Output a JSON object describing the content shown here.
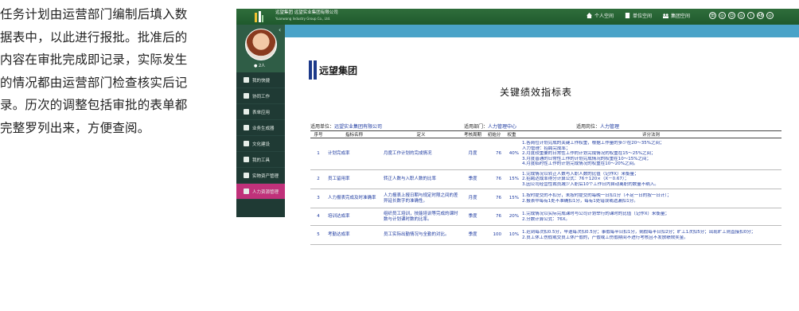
{
  "intro": "任务计划由运营部门编制后填入数据表中，以此进行报批。批准后的内容在审批完成即记录，实际发生的情况都由运营部门检查核实后记录。历次的调整包括审批的表单都完整罗列出来，方便查阅。",
  "header": {
    "brand_cn": "远望集团  远望实业集团有限公司",
    "brand_en": "Yuanwang Industry Group Co., Ltd.",
    "nav": [
      {
        "label": "个人空间",
        "icon": "home-icon"
      },
      {
        "label": "单位空间",
        "icon": "building-icon"
      },
      {
        "label": "集团空间",
        "icon": "group-icon"
      }
    ],
    "circles": [
      "田",
      "◎",
      "☺",
      "◎",
      "i",
      "AB",
      "◎"
    ]
  },
  "sidebar": {
    "status": "● 2人",
    "collapse": "‹",
    "items": [
      {
        "label": "我的快捷",
        "icon": "plus-circle-icon"
      },
      {
        "label": "协同工作",
        "icon": "people-icon"
      },
      {
        "label": "表单应用",
        "icon": "form-icon"
      },
      {
        "label": "业务生成器",
        "icon": "house-icon"
      },
      {
        "label": "文化建设",
        "icon": "culture-icon"
      },
      {
        "label": "我的工具",
        "icon": "toolbox-icon"
      },
      {
        "label": "实物资产管理",
        "icon": "asset-icon"
      },
      {
        "label": "人力资源管理",
        "icon": "hr-icon"
      }
    ],
    "active_index": 7
  },
  "doc": {
    "logo_text": "远望集团",
    "title": "关键绩效指标表",
    "unit_label": "适用单位：",
    "unit_value": "远望实业集团有限公司",
    "dept_label": "适用部门：",
    "dept_value": "人力管理中心",
    "post_label": "适用岗位：",
    "post_value": "人力管理",
    "columns": [
      "序号",
      "指标名称",
      "定义",
      "考核周期",
      "初始分",
      "权重",
      "评分法则"
    ],
    "rows": [
      {
        "no": "1",
        "name": "计划完成率",
        "def": "月度工作计划的完成情况",
        "cycle": "月度",
        "score": "76",
        "weight": "40%",
        "rules": [
          "1.各岗位计划完成的关键工作权重，根据工作量的多少在20～35%之间；",
          "   人力管理：招聘完成率；",
          "2.月度较重要的日常性工作的计划完成情况的权重在15～25%之间；",
          "3.月度普通的日常性工作的计划完成情况的权重在10～15%之间；",
          "4.月度临时性工作的计划完成情况的权重在10～20%之间。"
        ]
      },
      {
        "no": "2",
        "name": "员工留用率",
        "def": "转正人数与入职人数的比率",
        "cycle": "季度",
        "score": "76",
        "weight": "15%",
        "rules": [
          "1.完成情况以转正人数与入职人数的比值（记作X）来衡量；",
          "2.招聘达成率得分计算公式：76＋120×（X－0.67）；",
          "3.因公司经营性裁员减少入职后10个工作日内自动离职的数量不纳入。"
        ]
      },
      {
        "no": "3",
        "name": "人力报表完成及时准确率",
        "def": "人力报表上报日期与规定时限之间的差异延长数字的准确性。",
        "cycle": "月度",
        "score": "76",
        "weight": "15%",
        "rules": [
          "1.按时提交的不扣分，未按时提交的每晚一日扣1分（不足一日的按一日计）；",
          "2.报表中每有1处不准确扣1分，每有1处错误或遗漏扣1分。"
        ]
      },
      {
        "no": "4",
        "name": "培训达成率",
        "def": "组织员工培训，技能培训等完成的课时数与计划课时数的比率。",
        "cycle": "季度",
        "score": "76",
        "weight": "20%",
        "rules": [
          "1.完成情况以实际完成课时与公司计划举行的课时的比值（记作X）来衡量；",
          "2.分数计算公式：76X。"
        ]
      },
      {
        "no": "5",
        "name": "考勤达成率",
        "def": "员工实际出勤情况与全勤的对比。",
        "cycle": "季度",
        "score": "100",
        "weight": "10%",
        "rules": [
          "1.迟到每次扣0.5分，早退每次扣0.5分；事假每半日扣1分，病假每半日扣2分；旷工1次扣5分；出现旷工则直接扣0分；",
          "2.员工休工伤假或交员工休产假的，产假或工伤假期间不进行考核且不发放绩效奖金。"
        ]
      }
    ]
  }
}
